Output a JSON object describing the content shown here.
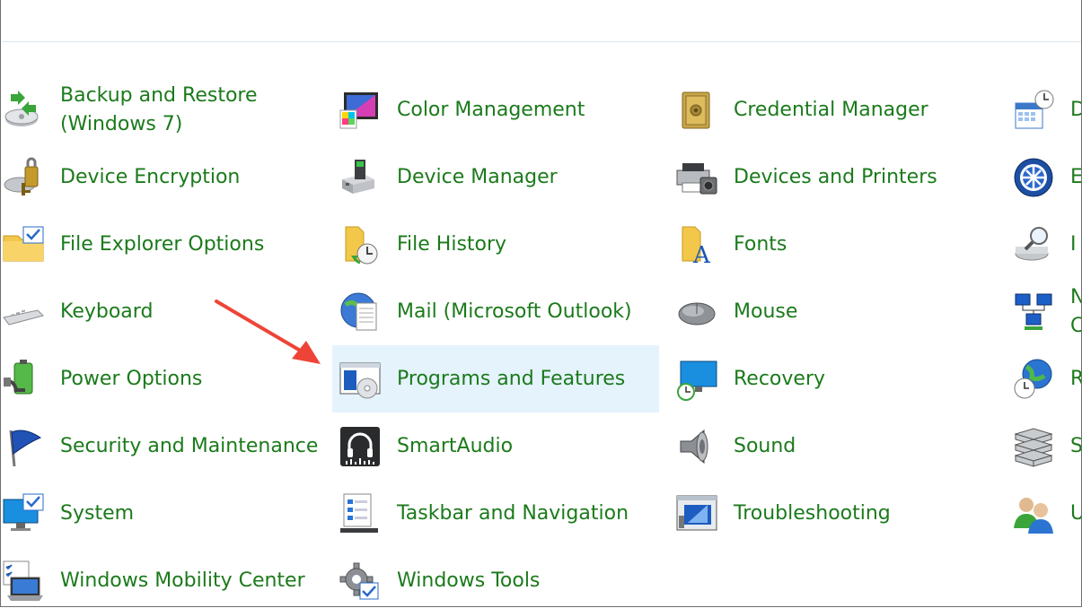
{
  "colors": {
    "link": "#1b7a1b",
    "highlight": "#e5f3fd",
    "arrow": "#ee4437"
  },
  "items": [
    {
      "label": "Backup and Restore (Windows 7)",
      "icon": "backup-restore-icon"
    },
    {
      "label": "Color Management",
      "icon": "color-management-icon"
    },
    {
      "label": "Credential Manager",
      "icon": "credential-manager-icon"
    },
    {
      "label": "D",
      "icon": "date-time-icon"
    },
    {
      "label": "Device Encryption",
      "icon": "device-encryption-icon"
    },
    {
      "label": "Device Manager",
      "icon": "device-manager-icon"
    },
    {
      "label": "Devices and Printers",
      "icon": "devices-printers-icon"
    },
    {
      "label": "E",
      "icon": "ease-of-access-icon"
    },
    {
      "label": "File Explorer Options",
      "icon": "file-explorer-options-icon"
    },
    {
      "label": "File History",
      "icon": "file-history-icon"
    },
    {
      "label": "Fonts",
      "icon": "fonts-icon"
    },
    {
      "label": "I",
      "icon": "indexing-options-icon"
    },
    {
      "label": "Keyboard",
      "icon": "keyboard-icon"
    },
    {
      "label": "Mail (Microsoft Outlook)",
      "icon": "mail-icon"
    },
    {
      "label": "Mouse",
      "icon": "mouse-icon"
    },
    {
      "label": "N\nC",
      "icon": "network-center-icon"
    },
    {
      "label": "Power Options",
      "icon": "power-options-icon"
    },
    {
      "label": "Programs and Features",
      "icon": "programs-features-icon"
    },
    {
      "label": "Recovery",
      "icon": "recovery-icon"
    },
    {
      "label": "R",
      "icon": "region-icon"
    },
    {
      "label": "Security and Maintenance",
      "icon": "security-maintenance-icon"
    },
    {
      "label": "SmartAudio",
      "icon": "smartaudio-icon"
    },
    {
      "label": "Sound",
      "icon": "sound-icon"
    },
    {
      "label": "S",
      "icon": "storage-spaces-icon"
    },
    {
      "label": "System",
      "icon": "system-icon"
    },
    {
      "label": "Taskbar and Navigation",
      "icon": "taskbar-icon"
    },
    {
      "label": "Troubleshooting",
      "icon": "troubleshooting-icon"
    },
    {
      "label": "U",
      "icon": "user-accounts-icon"
    },
    {
      "label": "Windows Mobility Center",
      "icon": "mobility-center-icon"
    },
    {
      "label": "Windows Tools",
      "icon": "windows-tools-icon"
    }
  ]
}
